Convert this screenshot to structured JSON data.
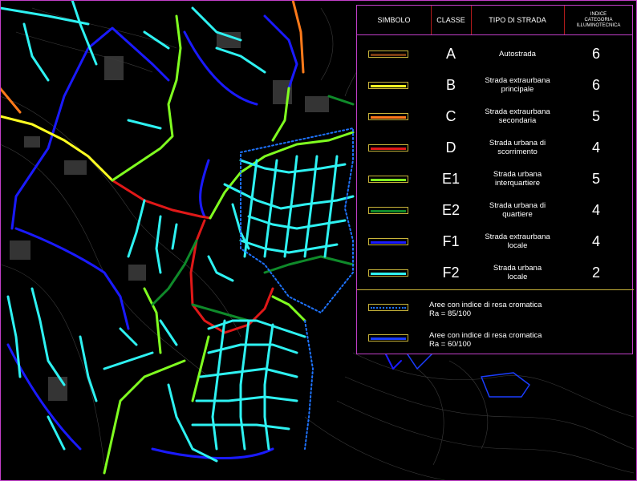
{
  "legend": {
    "header": {
      "simbolo": "SIMBOLO",
      "classe": "CLASSE",
      "tipo": "TIPO DI STRADA",
      "indice_1": "INDICE",
      "indice_2": "CATEGORIA",
      "indice_3": "ILLUMINOTECNICA"
    },
    "rows": [
      {
        "classe": "A",
        "tipo_1": "Autostrada",
        "tipo_2": "",
        "indice": "6",
        "color": "#7a3b13"
      },
      {
        "classe": "B",
        "tipo_1": "Strada extraurbana",
        "tipo_2": "principale",
        "indice": "6",
        "color": "#ffff22"
      },
      {
        "classe": "C",
        "tipo_1": "Strada extraurbana",
        "tipo_2": "secondaria",
        "indice": "5",
        "color": "#ff7a1a"
      },
      {
        "classe": "D",
        "tipo_1": "Strada urbana di",
        "tipo_2": "scorrimento",
        "indice": "4",
        "color": "#e01818"
      },
      {
        "classe": "E1",
        "tipo_1": "Strada urbana",
        "tipo_2": "interquartiere",
        "indice": "5",
        "color": "#80ff20"
      },
      {
        "classe": "E2",
        "tipo_1": "Strada urbana  di",
        "tipo_2": "quartiere",
        "indice": "4",
        "color": "#0f8a2a"
      },
      {
        "classe": "F1",
        "tipo_1": "Strada extraurbana",
        "tipo_2": "locale",
        "indice": "4",
        "color": "#1a1aff"
      },
      {
        "classe": "F2",
        "tipo_1": "Strada urbana",
        "tipo_2": "locale",
        "indice": "2",
        "color": "#2ef2f2"
      }
    ],
    "areas": [
      {
        "text_1": "Aree con indice di resa cromatica",
        "text_2": "Ra = 85/100",
        "color": "#1e73ff",
        "style": "dotted"
      },
      {
        "text_1": "Aree con indice di resa cromatica",
        "text_2": "Ra = 60/100",
        "color": "#1a3dff",
        "style": "solid"
      }
    ],
    "border_color": "#c23fc9"
  }
}
